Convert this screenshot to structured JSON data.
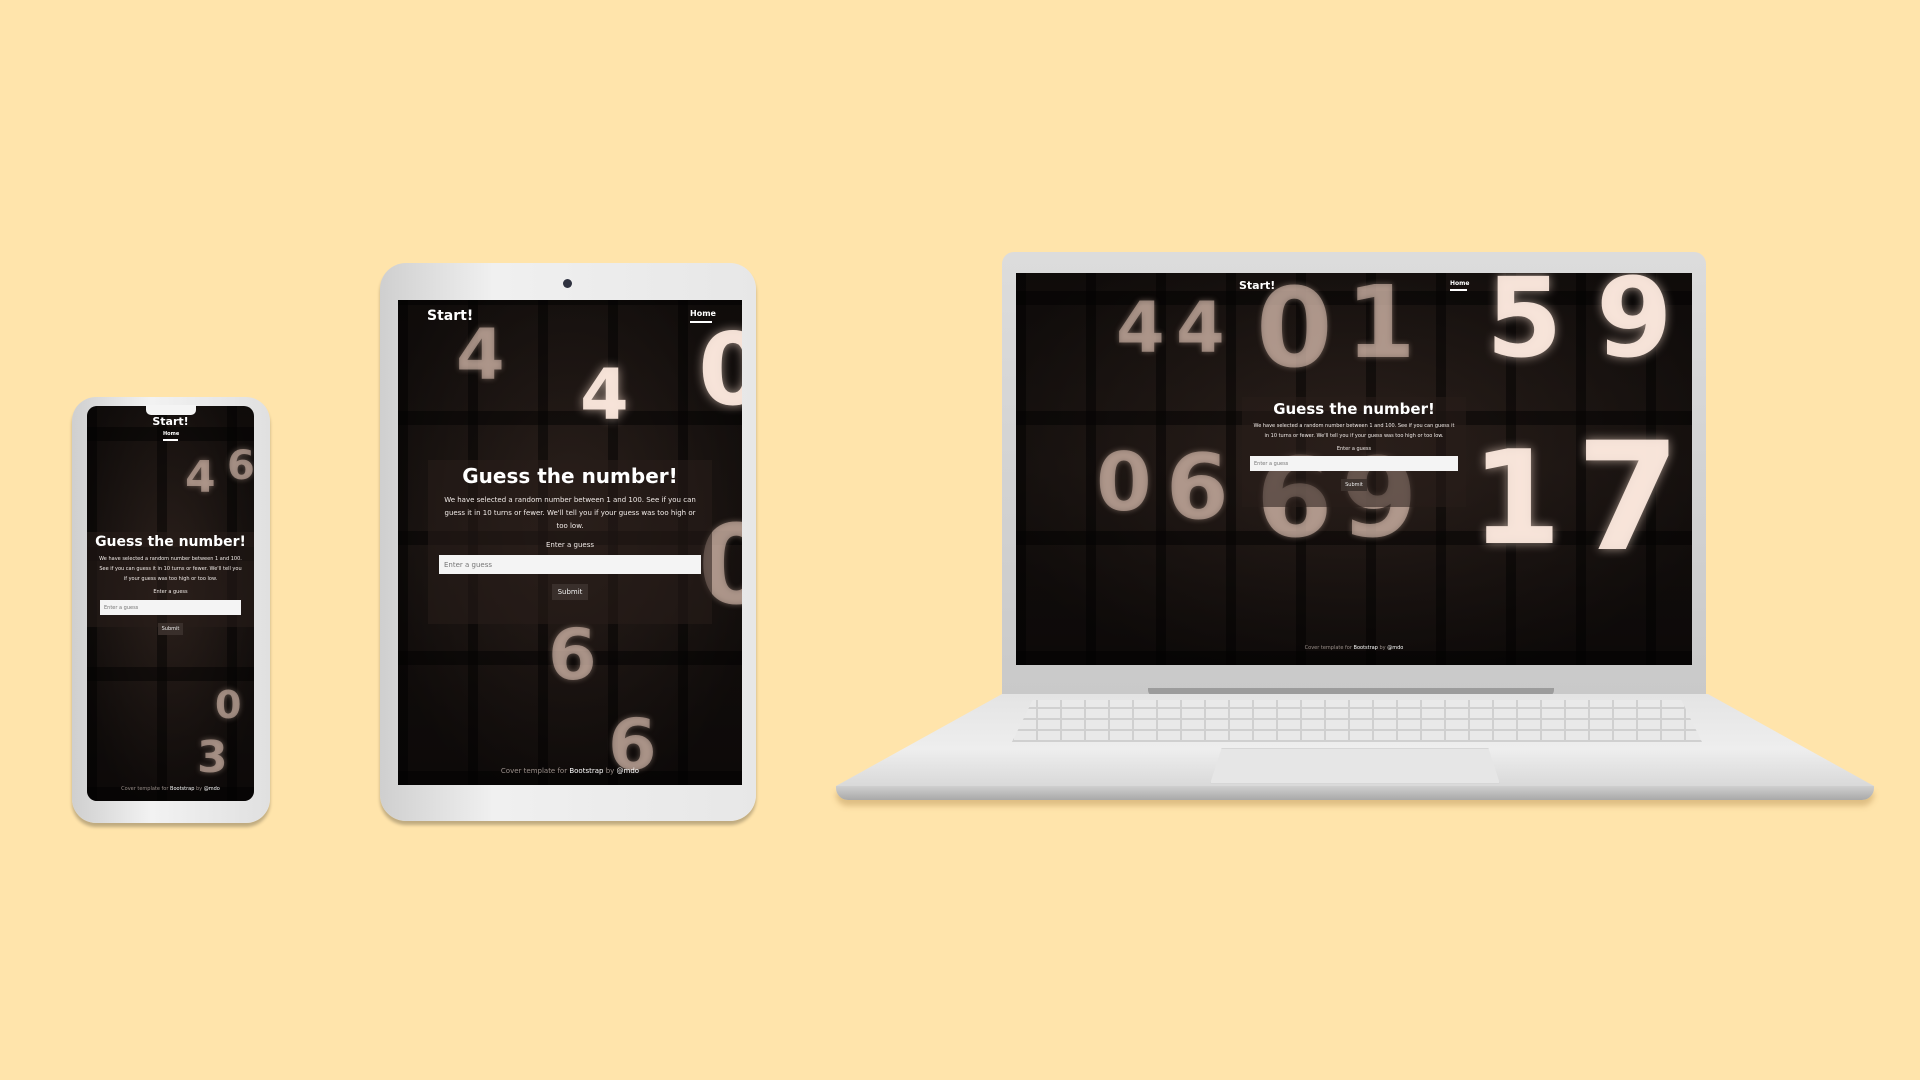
{
  "app": {
    "brand": "Start!",
    "nav": [
      "Home"
    ],
    "heading": "Guess the number!",
    "description": "We have selected a random number between 1 and 100. See if you can guess it in 10 turns or fewer. We'll tell you if your guess was too high or too low.",
    "input_label": "Enter a guess",
    "input_placeholder": "Enter a guess",
    "submit_label": "Submit",
    "footer": {
      "prefix": "Cover template for",
      "link1": "Bootstrap",
      "middle": "by",
      "link2": "@mdo"
    }
  },
  "colors": {
    "background": "#ffe4ab",
    "screen": "#221a17",
    "device_frame": "#e4e4e4"
  },
  "background_digits": [
    "4",
    "4",
    "0",
    "0",
    "5",
    "6",
    "6",
    "3",
    "5",
    "9",
    "1",
    "7"
  ]
}
